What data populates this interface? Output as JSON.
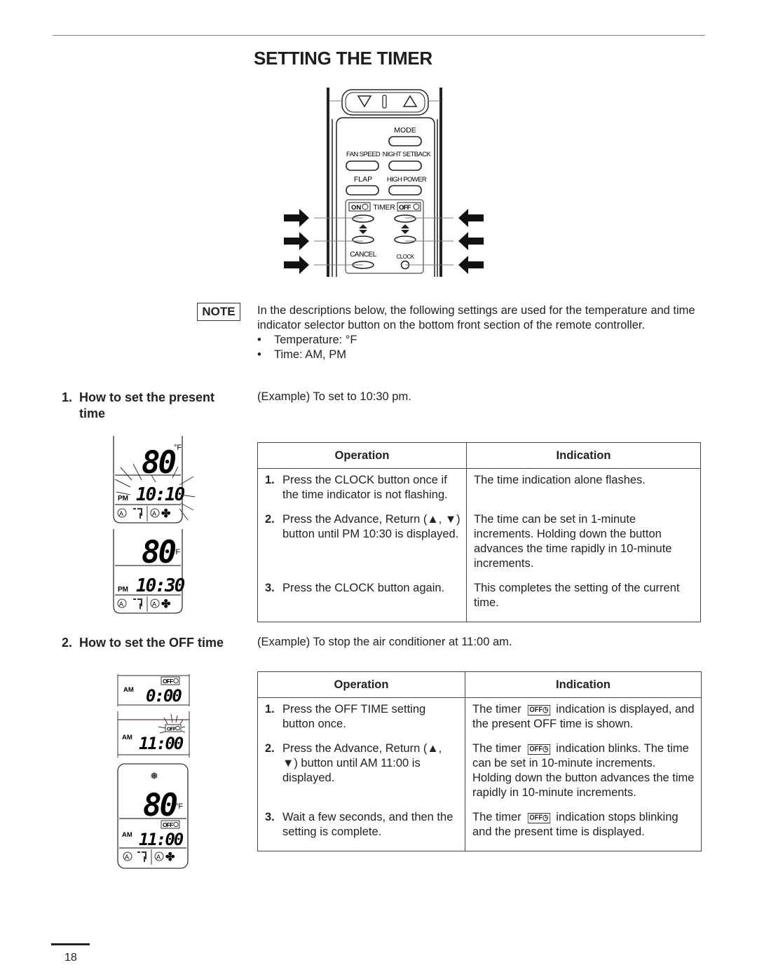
{
  "page": {
    "title": "SETTING THE TIMER",
    "page_number": "18"
  },
  "remote": {
    "top_buttons": [
      "down-arrow",
      "up-arrow"
    ],
    "labels": {
      "mode": "MODE",
      "fan_speed": "FAN SPEED",
      "night_setback": "NIGHT SETBACK",
      "flap": "FLAP",
      "high_power": "HIGH POWER",
      "on_timer": "ON",
      "timer": "TIMER",
      "off_timer": "OFF",
      "cancel": "CANCEL",
      "clock": "CLOCK"
    }
  },
  "note": {
    "label": "NOTE",
    "text": "In the descriptions below, the following settings are used for the temperature and time indicator selector button on the bottom front section of the remote controller.",
    "bullets": [
      "Temperature: °F",
      "Time: AM, PM"
    ]
  },
  "section1": {
    "number": "1.",
    "heading_line1": "How to set the present",
    "heading_line2": "time",
    "example": "(Example) To set to 10:30 pm.",
    "displays": [
      {
        "temp": "80",
        "unit": "°F",
        "period": "PM",
        "time": "10:10",
        "flashing": true
      },
      {
        "temp": "80",
        "unit": "°F",
        "period": "PM",
        "time": "10:30",
        "flashing": false
      }
    ],
    "table": {
      "headers": [
        "Operation",
        "Indication"
      ],
      "rows": [
        {
          "n": "1.",
          "op": "Press the CLOCK button once if the time indicator is not flashing.",
          "ind": "The time indication alone flashes."
        },
        {
          "n": "2.",
          "op": "Press the Advance, Return (▲, ▼) button until PM 10:30 is displayed.",
          "ind": "The time can be set in 1-minute increments. Holding down the button advances the time rapidly in 10-minute increments."
        },
        {
          "n": "3.",
          "op": "Press the CLOCK button again.",
          "ind": "This completes the setting of the current time."
        }
      ]
    }
  },
  "section2": {
    "number": "2.",
    "heading": "How to set the OFF time",
    "example": "(Example) To stop the air conditioner at 11:00 am.",
    "displays": [
      {
        "badge": "OFF",
        "period": "AM",
        "time": "0:00"
      },
      {
        "badge": "OFF",
        "period": "AM",
        "time": "11:00",
        "blinking": true
      },
      {
        "temp": "80",
        "unit": "°F",
        "badge": "OFF",
        "period": "AM",
        "time": "11:00"
      }
    ],
    "table": {
      "headers": [
        "Operation",
        "Indication"
      ],
      "badge": "OFF",
      "rows": [
        {
          "n": "1.",
          "op": "Press the OFF TIME setting button once.",
          "ind_pre": "The timer",
          "ind_post": "indication is displayed, and the present OFF time is shown."
        },
        {
          "n": "2.",
          "op": "Press the Advance, Return (▲, ▼) button until AM 11:00 is displayed.",
          "ind_pre": "The timer",
          "ind_post": "indication blinks. The time can be set in 10-minute increments. Holding down the button advances the time rapidly in 10-minute increments."
        },
        {
          "n": "3.",
          "op": "Wait a few seconds, and then the setting is complete.",
          "ind_pre": "The timer",
          "ind_post": "indication stops blinking and the present time is displayed."
        }
      ]
    }
  }
}
